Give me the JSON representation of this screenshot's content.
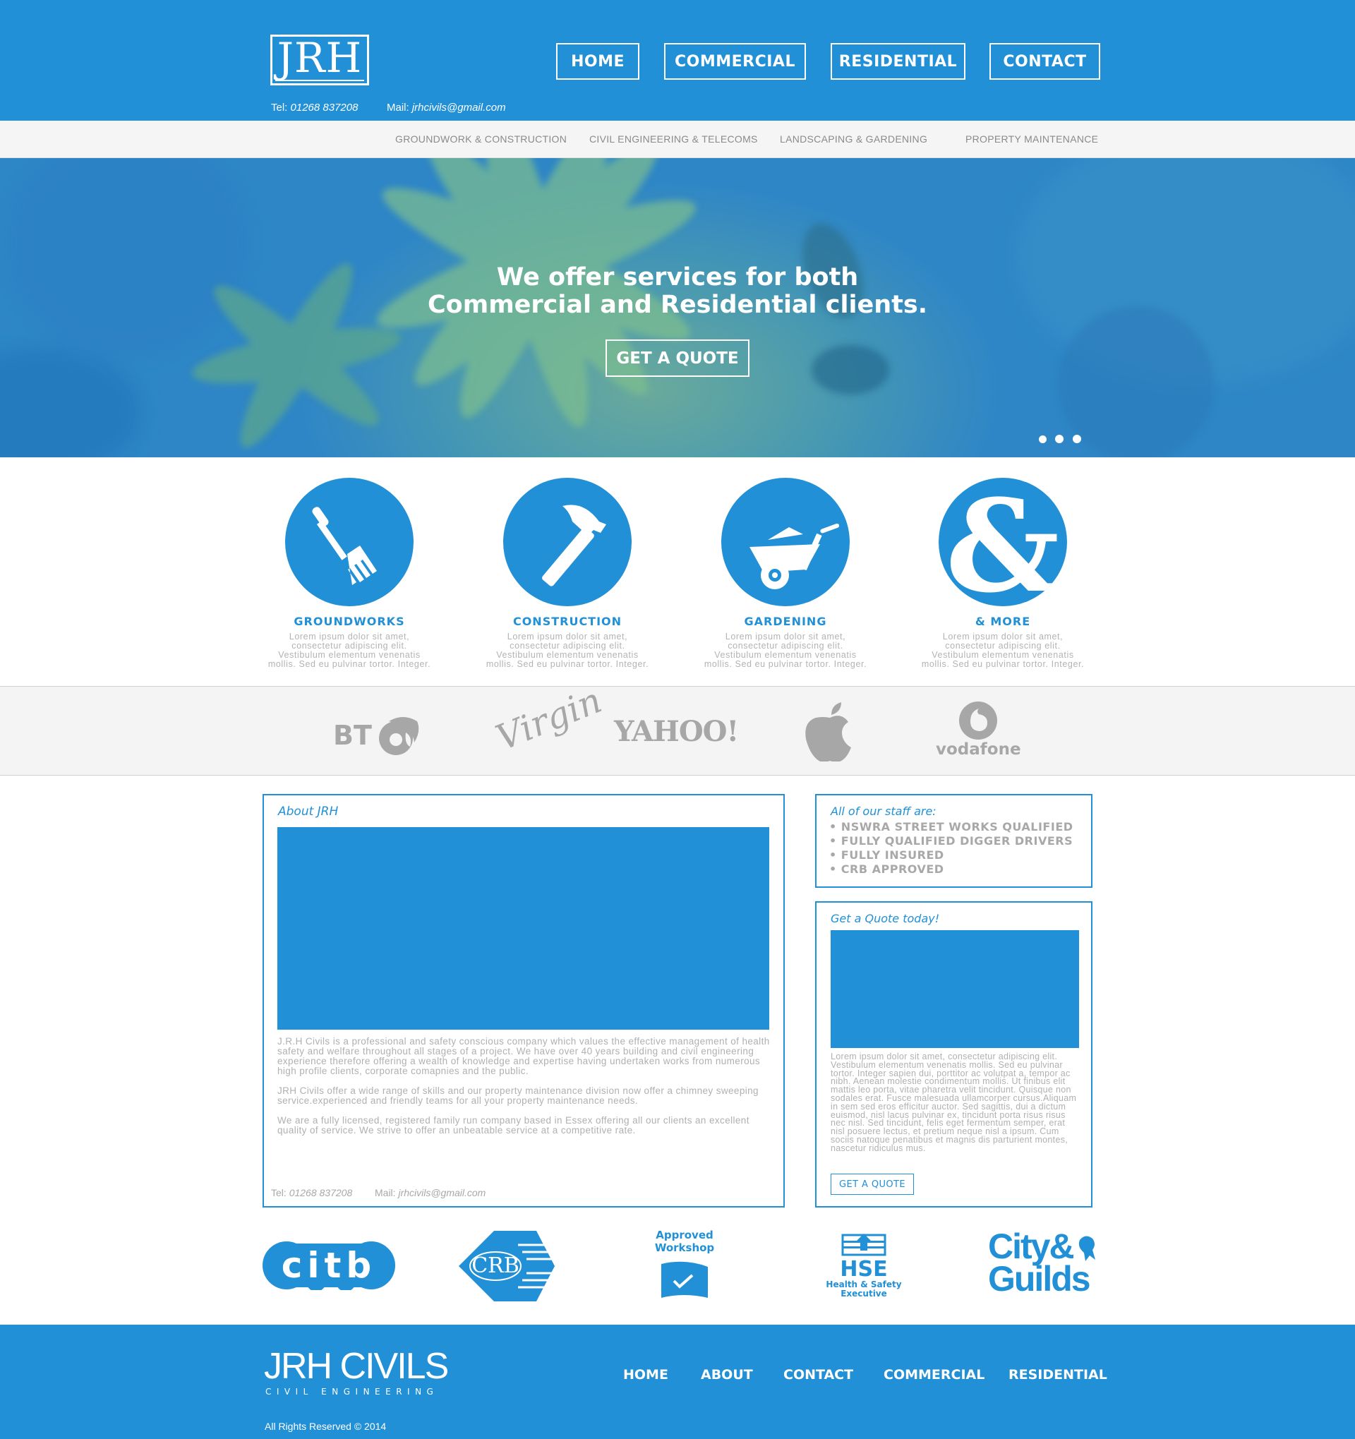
{
  "header": {
    "logo_text": "JRH",
    "nav": [
      "HOME",
      "COMMERCIAL",
      "RESIDENTIAL",
      "CONTACT"
    ],
    "tel_label": "Tel:",
    "tel_value": "01268 837208",
    "mail_label": "Mail:",
    "mail_value": "jrhcivils@gmail.com"
  },
  "subnav": [
    "GROUNDWORK & CONSTRUCTION",
    "CIVIL ENGINEERING & TELECOMS",
    "LANDSCAPING & GARDENING",
    "PROPERTY MAINTENANCE"
  ],
  "hero": {
    "line1": "We offer services for both",
    "line2": "Commercial and Residential clients.",
    "button": "GET A QUOTE"
  },
  "services": [
    {
      "title": "GROUNDWORKS",
      "icon": "fork-spade-icon",
      "l1": "Lorem ipsum dolor sit amet,",
      "l2": "consectetur adipiscing elit.",
      "l3": "Vestibulum elementum venenatis",
      "l4": "mollis. Sed eu pulvinar tortor. Integer."
    },
    {
      "title": "CONSTRUCTION",
      "icon": "hammer-icon",
      "l1": "Lorem ipsum dolor sit amet,",
      "l2": "consectetur adipiscing elit.",
      "l3": "Vestibulum elementum venenatis",
      "l4": "mollis. Sed eu pulvinar tortor. Integer."
    },
    {
      "title": "GARDENING",
      "icon": "wheelbarrow-icon",
      "l1": "Lorem ipsum dolor sit amet,",
      "l2": "consectetur adipiscing elit.",
      "l3": "Vestibulum elementum venenatis",
      "l4": "mollis. Sed eu pulvinar tortor. Integer."
    },
    {
      "title": "& MORE",
      "icon": "ampersand-icon",
      "l1": "Lorem ipsum dolor sit amet,",
      "l2": "consectetur adipiscing elit.",
      "l3": "Vestibulum elementum venenatis",
      "l4": "mollis. Sed eu pulvinar tortor. Integer."
    }
  ],
  "clients": {
    "bt": "BT",
    "virgin": "Virgin",
    "yahoo": "YAHOO!",
    "apple": "apple-logo",
    "vodafone": "vodafone"
  },
  "about": {
    "heading": "About JRH",
    "p1": "J.R.H Civils is a professional and safety conscious company which values the effective management of health safety and welfare throughout all stages of a project. We have over 40 years building and civil engineering experience therefore offering a wealth of knowledge and expertise having undertaken works from numerous high profile clients, corporate comapnies and the public.",
    "p2": "JRH Civils offer a wide range of skills and our property maintenance division now offer a chimney sweeping service.experienced and friendly teams for all your property maintenance needs.",
    "p3": "We are a fully licensed, registered family run company based in Essex offering all our clients an excellent quality of service.  We strive to offer an unbeatable service at a competitive rate.",
    "tel_label": "Tel:",
    "tel_value": "01268 837208",
    "mail_label": "Mail:",
    "mail_value": "jrhcivils@gmail.com"
  },
  "staff": {
    "heading": "All of our staff are:",
    "items": [
      "NSWRA STREET WORKS QUALIFIED",
      "FULLY QUALIFIED DIGGER DRIVERS",
      "FULLY INSURED",
      "CRB APPROVED"
    ]
  },
  "quote": {
    "heading": "Get a Quote today!",
    "text": "Lorem ipsum dolor sit amet, consectetur adipiscing elit. Vestibulum elementum venenatis mollis. Sed eu pulvinar tortor. Integer sapien dui, porttitor ac volutpat a, tempor ac nibh. Aenean molestie condimentum mollis. Ut finibus elit mattis leo porta, vitae pharetra velit tincidunt. Quisque non sodales erat. Fusce malesuada ullamcorper cursus.Aliquam in sem sed eros efficitur auctor. Sed sagittis, dui a dictum euismod, nisl lacus pulvinar ex, tincidunt porta risus risus nec nisl. Sed tincidunt, felis eget fermentum semper, erat nisl posuere lectus, et pretium neque nisl a ipsum. Cum sociis natoque penatibus et magnis dis parturient montes, nascetur ridiculus mus.",
    "button": "GET A QUOTE"
  },
  "accreditations": {
    "citb": "citb",
    "crb": "CRB",
    "approved_l1": "Approved",
    "approved_l2": "Workshop",
    "hse": "HSE",
    "hse_l1": "Health & Safety",
    "hse_l2": "Executive",
    "cg_l1": "City&",
    "cg_l2": "Guilds"
  },
  "footer": {
    "logo": "JRH CIVILS",
    "logo_sub": "CIVIL ENGINEERING",
    "nav": [
      "HOME",
      "ABOUT",
      "CONTACT",
      "COMMERCIAL",
      "RESIDENTIAL"
    ],
    "copyright": "All Rights Reserved © 2014"
  },
  "colors": {
    "brand_blue": "#2190d6",
    "light_gray": "#f5f5f5",
    "text_gray": "#b0b0b0"
  }
}
